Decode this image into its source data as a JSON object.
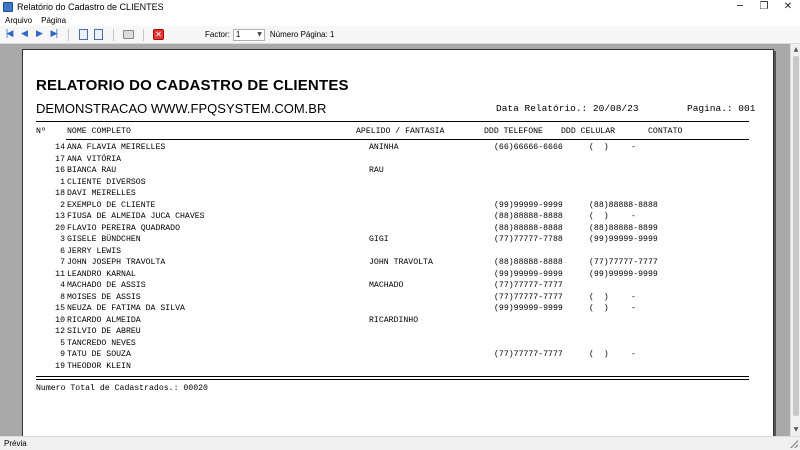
{
  "window": {
    "title": "Relatório do Cadastro de CLIENTES",
    "minimize": "─",
    "restore": "❐",
    "close": "✕"
  },
  "menu": {
    "items": [
      "Arquivo",
      "Página"
    ]
  },
  "toolbar": {
    "factor_label": "Factor:",
    "factor_value": "1",
    "page_label": "Número Página: 1",
    "first": "|◀",
    "prev": "◀",
    "next": "▶",
    "last": "▶|",
    "close": "✕"
  },
  "report": {
    "title": "RELATORIO DO CADASTRO DE CLIENTES",
    "company": "DEMONSTRACAO WWW.FPQSYSTEM.COM.BR",
    "date_label": "Data Relatório.: 20/08/23",
    "page_label": "Pagina.: 001",
    "columns": {
      "id": "Nº",
      "name": "NOME COMPLETO",
      "nick": "APELIDO / FANTASIA",
      "phone": "DDD TELEFONE",
      "cell": "DDD CELULAR",
      "contact": "CONTATO"
    },
    "rows": [
      {
        "id": "14",
        "name": "ANA FLAVIA MEIRELLES",
        "nick": "ANINHA",
        "tel": "(66)66666-6666",
        "cel": "(  )",
        "contact": "-"
      },
      {
        "id": "17",
        "name": "ANA VITÓRIA",
        "nick": "",
        "tel": "",
        "cel": "",
        "contact": ""
      },
      {
        "id": "16",
        "name": "BIANCA RAU",
        "nick": "RAU",
        "tel": "",
        "cel": "",
        "contact": ""
      },
      {
        "id": "1",
        "name": "CLIENTE DIVERSOS",
        "nick": "",
        "tel": "",
        "cel": "",
        "contact": ""
      },
      {
        "id": "18",
        "name": "DAVI MEIRELLES",
        "nick": "",
        "tel": "",
        "cel": "",
        "contact": ""
      },
      {
        "id": "2",
        "name": "EXEMPLO DE CLIENTE",
        "nick": "",
        "tel": "(99)99999-9999",
        "cel": "(88)88888-8888",
        "contact": ""
      },
      {
        "id": "13",
        "name": "FIUSA DE ALMEIDA JUCA CHAVES",
        "nick": "",
        "tel": "(88)88888-8888",
        "cel": "(  )",
        "contact": "-"
      },
      {
        "id": "20",
        "name": "FLAVIO PEREIRA QUADRADO",
        "nick": "",
        "tel": "(88)88888-8888",
        "cel": "(88)88888-8899",
        "contact": ""
      },
      {
        "id": "3",
        "name": "GISELE BÜNDCHEN",
        "nick": "GIGI",
        "tel": "(77)77777-7788",
        "cel": "(99)99999-9999",
        "contact": ""
      },
      {
        "id": "6",
        "name": "JERRY LEWIS",
        "nick": "",
        "tel": "",
        "cel": "",
        "contact": ""
      },
      {
        "id": "7",
        "name": "JOHN JOSEPH TRAVOLTA",
        "nick": "JOHN TRAVOLTA",
        "tel": "(88)88888-8888",
        "cel": "(77)77777-7777",
        "contact": ""
      },
      {
        "id": "11",
        "name": "LEANDRO KARNAL",
        "nick": "",
        "tel": "(99)99999-9999",
        "cel": "(99)99999-9999",
        "contact": ""
      },
      {
        "id": "4",
        "name": "MACHADO DE ASSIS",
        "nick": "MACHADO",
        "tel": "(77)77777-7777",
        "cel": "",
        "contact": ""
      },
      {
        "id": "8",
        "name": "MOISES DE ASSIS",
        "nick": "",
        "tel": "(77)77777-7777",
        "cel": "(  )",
        "contact": "-"
      },
      {
        "id": "15",
        "name": "NEUZA DE FATIMA DA SILVA",
        "nick": "",
        "tel": "(99)99999-9999",
        "cel": "(  )",
        "contact": "-"
      },
      {
        "id": "10",
        "name": "RICARDO ALMEIDA",
        "nick": "RICARDINHO",
        "tel": "",
        "cel": "",
        "contact": ""
      },
      {
        "id": "12",
        "name": "SILVIO DE ABREU",
        "nick": "",
        "tel": "",
        "cel": "",
        "contact": ""
      },
      {
        "id": "5",
        "name": "TANCREDO NEVES",
        "nick": "",
        "tel": "",
        "cel": "",
        "contact": ""
      },
      {
        "id": "9",
        "name": "TATU DE SOUZA",
        "nick": "",
        "tel": "(77)77777-7777",
        "cel": "(  )",
        "contact": "-"
      },
      {
        "id": "19",
        "name": "THEODOR KLEIN",
        "nick": "",
        "tel": "",
        "cel": "",
        "contact": ""
      }
    ],
    "total_label": "Numero Total de Cadastrados.: 00020"
  },
  "status": {
    "text": "Prévia"
  }
}
